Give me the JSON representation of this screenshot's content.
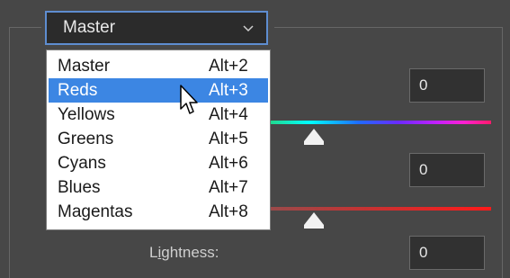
{
  "channel_select": {
    "value": "Master"
  },
  "fields": {
    "hue_value": "0",
    "saturation_value": "0",
    "lightness_value": "0"
  },
  "lightness_label": {
    "prefix": "L",
    "underlined": "i",
    "rest": "ghtness:"
  },
  "dropdown": {
    "items": [
      {
        "label": "Master",
        "shortcut": "Alt+2",
        "selected": false
      },
      {
        "label": "Reds",
        "shortcut": "Alt+3",
        "selected": true
      },
      {
        "label": "Yellows",
        "shortcut": "Alt+4",
        "selected": false
      },
      {
        "label": "Greens",
        "shortcut": "Alt+5",
        "selected": false
      },
      {
        "label": "Cyans",
        "shortcut": "Alt+6",
        "selected": false
      },
      {
        "label": "Blues",
        "shortcut": "Alt+7",
        "selected": false
      },
      {
        "label": "Magentas",
        "shortcut": "Alt+8",
        "selected": false
      }
    ]
  },
  "colors": {
    "selection": "#3c86e3",
    "panel": "#474747",
    "focus_border": "#5e8dd0"
  },
  "icons": {
    "select_chevron": "chevron-down-icon",
    "cursor": "mouse-pointer-icon"
  }
}
